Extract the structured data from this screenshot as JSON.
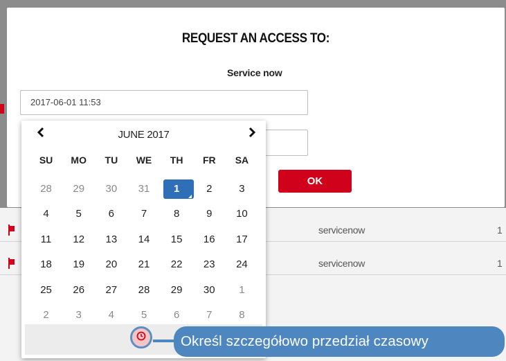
{
  "modal": {
    "title": "REQUEST AN ACCESS TO:",
    "subtitle": "Service now",
    "datetime_value": "2017-06-01 11:53",
    "ok_label": "OK"
  },
  "datepicker": {
    "prev_label": "‹",
    "next_label": "›",
    "month_label": "JUNE 2017",
    "weekdays": [
      "SU",
      "MO",
      "TU",
      "WE",
      "TH",
      "FR",
      "SA"
    ],
    "weeks": [
      [
        "28",
        "29",
        "30",
        "31",
        "1",
        "2",
        "3"
      ],
      [
        "4",
        "5",
        "6",
        "7",
        "8",
        "9",
        "10"
      ],
      [
        "11",
        "12",
        "13",
        "14",
        "15",
        "16",
        "17"
      ],
      [
        "18",
        "19",
        "20",
        "21",
        "22",
        "23",
        "24"
      ],
      [
        "25",
        "26",
        "27",
        "28",
        "29",
        "30",
        "1"
      ],
      [
        "2",
        "3",
        "4",
        "5",
        "6",
        "7",
        "8"
      ]
    ],
    "selected_day": "1"
  },
  "background_table": {
    "rows": [
      {
        "service": "servicenow",
        "trailing": "1"
      },
      {
        "service": "servicenow",
        "trailing": "1"
      }
    ]
  },
  "tooltip": {
    "text": "Określ szczegółowo przedział czasowy"
  },
  "colors": {
    "accent_red": "#d0021b",
    "selected_blue": "#2f6fb8",
    "tooltip_blue": "#4e86bf"
  },
  "icons": [
    "clock-icon",
    "flag-icon",
    "chevron-left-icon",
    "chevron-right-icon"
  ]
}
